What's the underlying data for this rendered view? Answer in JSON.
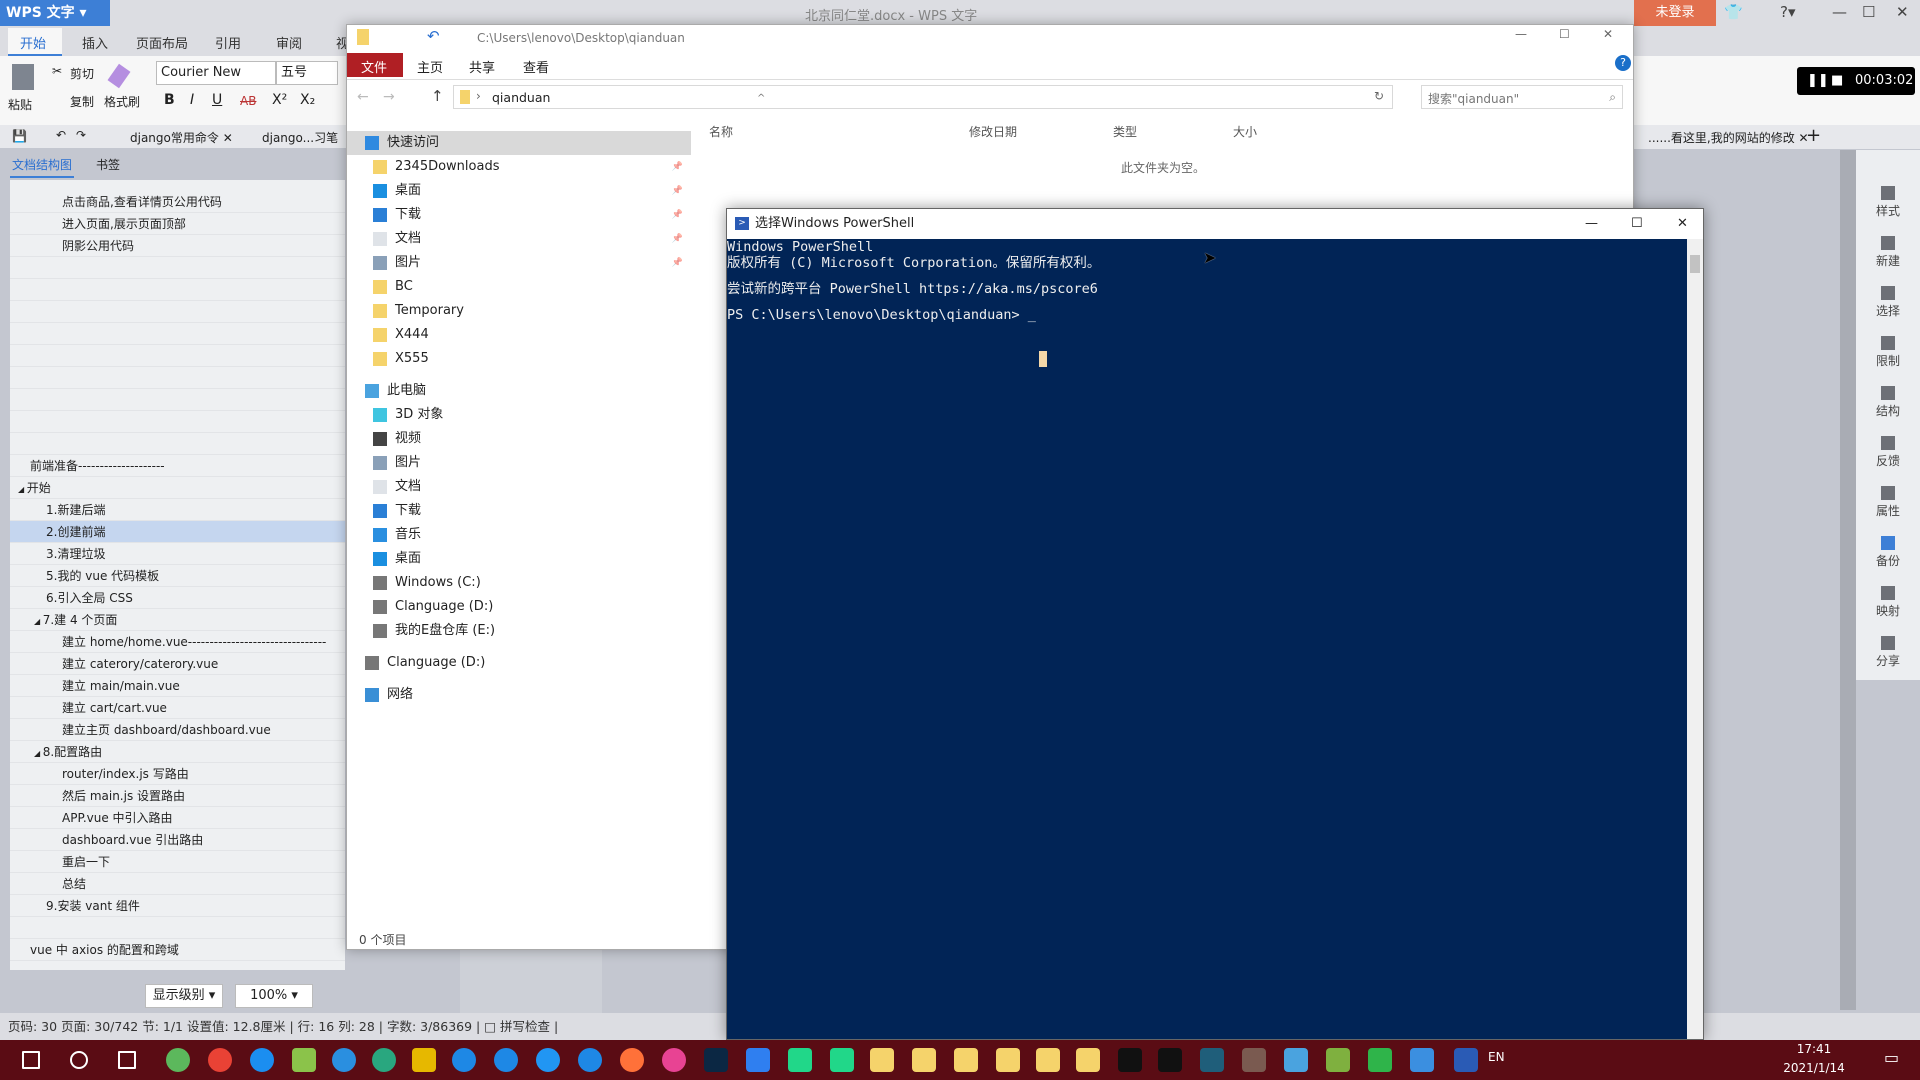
{
  "wps": {
    "logo": "WPS 文字",
    "doc_title": "北京同仁堂.docx - WPS 文字",
    "login": "未登录",
    "tabs": [
      "开始",
      "插入",
      "页面布局",
      "引用",
      "审阅",
      "视"
    ],
    "toolbar": {
      "paste": "粘贴",
      "cut": "剪切",
      "copy": "复制",
      "format_painter": "格式刷",
      "font": "Courier New",
      "size": "五号",
      "bold": "B",
      "italic": "I",
      "underline": "U",
      "strike": "AB",
      "sup": "X²",
      "sub": "X₂"
    },
    "doc_tabs": [
      "django常用命令",
      "django...习笔",
      "......看这里,我的网站的修改"
    ],
    "panel_tabs": [
      "文档结构图",
      "书签"
    ],
    "nav": [
      {
        "t": "点击商品,查看详情页公用代码",
        "l": 3
      },
      {
        "t": "进入页面,展示页面顶部",
        "l": 3
      },
      {
        "t": "阴影公用代码",
        "l": 3
      },
      {
        "t": "",
        "l": 0
      },
      {
        "t": "",
        "l": 0
      },
      {
        "t": "",
        "l": 0
      },
      {
        "t": "",
        "l": 0
      },
      {
        "t": "",
        "l": 0
      },
      {
        "t": "",
        "l": 0
      },
      {
        "t": "",
        "l": 0
      },
      {
        "t": "",
        "l": 0
      },
      {
        "t": "",
        "l": 0
      },
      {
        "t": "前端准备--------------------",
        "l": 1
      },
      {
        "t": "开始",
        "l": 1,
        "exp": true
      },
      {
        "t": "1.新建后端",
        "l": 2
      },
      {
        "t": "2.创建前端",
        "l": 2,
        "sel": true
      },
      {
        "t": "3.清理垃圾",
        "l": 2
      },
      {
        "t": "5.我的 vue 代码模板",
        "l": 2
      },
      {
        "t": "6.引入全局 CSS",
        "l": 2
      },
      {
        "t": "7.建 4 个页面",
        "l": 2,
        "exp": true
      },
      {
        "t": "建立 home/home.vue--------------------------------",
        "l": 3
      },
      {
        "t": "建立 caterory/caterory.vue",
        "l": 3
      },
      {
        "t": "建立 main/main.vue",
        "l": 3
      },
      {
        "t": "建立 cart/cart.vue",
        "l": 3
      },
      {
        "t": "建立主页 dashboard/dashboard.vue",
        "l": 3
      },
      {
        "t": "8.配置路由",
        "l": 2,
        "exp": true
      },
      {
        "t": "router/index.js 写路由",
        "l": 3
      },
      {
        "t": "然后 main.js 设置路由",
        "l": 3
      },
      {
        "t": "APP.vue 中引入路由",
        "l": 3
      },
      {
        "t": "dashboard.vue 引出路由",
        "l": 3
      },
      {
        "t": "重启一下",
        "l": 3
      },
      {
        "t": "总结",
        "l": 3
      },
      {
        "t": "9.安装 vant 组件",
        "l": 2
      },
      {
        "t": "",
        "l": 0
      },
      {
        "t": "vue 中 axios 的配置和跨域",
        "l": 1
      }
    ],
    "level_dropdown": "显示级别",
    "zoom_dropdown": "100%",
    "status": "页码: 30  页面: 30/742  节: 1/1  设置值: 12.8厘米 | 行: 16  列: 28 | 字数: 3/86369 | □ 拼写检查 |",
    "right_sidebar": [
      "样式",
      "新建",
      "选择",
      "限制",
      "结构",
      "反馈",
      "属性",
      "备份",
      "映射",
      "分享"
    ],
    "recording_time": "00:03:02"
  },
  "explorer": {
    "path": "C:\\Users\\lenovo\\Desktop\\qianduan",
    "ribbon": [
      "文件",
      "主页",
      "共享",
      "查看"
    ],
    "address": "qianduan",
    "search_placeholder": "搜索\"qianduan\"",
    "columns": [
      "名称",
      "修改日期",
      "类型",
      "大小"
    ],
    "empty": "此文件夹为空。",
    "status": "0 个项目",
    "nav": [
      {
        "t": "快速访问",
        "l": 1,
        "i": "star",
        "sel": true
      },
      {
        "t": "2345Downloads",
        "l": 2,
        "i": "folder",
        "pin": true
      },
      {
        "t": "桌面",
        "l": 2,
        "i": "desktop",
        "pin": true
      },
      {
        "t": "下载",
        "l": 2,
        "i": "download",
        "pin": true
      },
      {
        "t": "文档",
        "l": 2,
        "i": "document",
        "pin": true
      },
      {
        "t": "图片",
        "l": 2,
        "i": "picture",
        "pin": true
      },
      {
        "t": "BC",
        "l": 2,
        "i": "folder"
      },
      {
        "t": "Temporary",
        "l": 2,
        "i": "folder"
      },
      {
        "t": "X444",
        "l": 2,
        "i": "folder"
      },
      {
        "t": "X555",
        "l": 2,
        "i": "folder"
      },
      {
        "t": "此电脑",
        "l": 1,
        "i": "computer",
        "gap": true
      },
      {
        "t": "3D 对象",
        "l": 2,
        "i": "cube"
      },
      {
        "t": "视频",
        "l": 2,
        "i": "video"
      },
      {
        "t": "图片",
        "l": 2,
        "i": "picture"
      },
      {
        "t": "文档",
        "l": 2,
        "i": "document"
      },
      {
        "t": "下载",
        "l": 2,
        "i": "download"
      },
      {
        "t": "音乐",
        "l": 2,
        "i": "music"
      },
      {
        "t": "桌面",
        "l": 2,
        "i": "desktop"
      },
      {
        "t": "Windows (C:)",
        "l": 2,
        "i": "drive"
      },
      {
        "t": "Clanguage (D:)",
        "l": 2,
        "i": "drive"
      },
      {
        "t": "我的E盘仓库 (E:)",
        "l": 2,
        "i": "drive"
      },
      {
        "t": "Clanguage (D:)",
        "l": 1,
        "i": "drive",
        "gap": true
      },
      {
        "t": "网络",
        "l": 1,
        "i": "network",
        "gap": true
      }
    ]
  },
  "powershell": {
    "title": "选择Windows PowerShell",
    "lines": [
      "Windows PowerShell",
      "版权所有 (C) Microsoft Corporation。保留所有权利。",
      "",
      "尝试新的跨平台 PowerShell https://aka.ms/pscore6",
      "",
      "PS C:\\Users\\lenovo\\Desktop\\qianduan> _"
    ]
  },
  "taskbar": {
    "icons": [
      "start",
      "search",
      "task-view",
      "360-browser",
      "chrome",
      "qq-browser",
      "notepad",
      "vscode",
      "visual-studio-code-insiders",
      "app-grid",
      "ie",
      "edge",
      "sogou-explorer",
      "sogou",
      "firefox",
      "picasa",
      "photoshop",
      "wps",
      "pycharm",
      "pycharm",
      "folder",
      "folder",
      "folder",
      "folder",
      "folder",
      "folder",
      "cmd",
      "cmd",
      "terminal-app",
      "avatar-app",
      "remote-app",
      "file-app",
      "hbuilder",
      "media-player",
      "powershell"
    ],
    "colors": [
      "#fff",
      "#fff",
      "#fff",
      "#5cb85c",
      "#e94235",
      "#1b8ef0",
      "#8bc34a",
      "#2a8fe0",
      "#29a77f",
      "#e6b800",
      "#1e88e5",
      "#1e88e5",
      "#2196f3",
      "#1e88e5",
      "#ff7139",
      "#e84393",
      "#0b2743",
      "#2f7ff0",
      "#21d789",
      "#21d789",
      "#f5d36b",
      "#f5d36b",
      "#f5d36b",
      "#f5d36b",
      "#f5d36b",
      "#f5d36b",
      "#111",
      "#111",
      "#1f5e7a",
      "#7a5a50",
      "#4aa3df",
      "#7fb03f",
      "#2fb44a",
      "#3b8fe0",
      "#2a5bb5"
    ],
    "lang": "EN",
    "time": "17:41",
    "date": "2021/1/14"
  },
  "colors": {
    "ps_bg": "#012456",
    "taskbar": "#5a0c14",
    "explorer_file_tab": "#b01f24",
    "wps_blue": "#3d7fd6"
  }
}
